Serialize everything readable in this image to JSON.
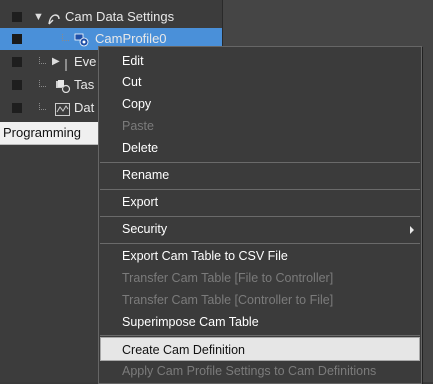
{
  "tree": {
    "items": [
      {
        "label": "Cam Data Settings",
        "expand": "▼",
        "icon": "cam-data-icon"
      },
      {
        "label": "CamProfile0",
        "icon": "cam-profile-icon"
      },
      {
        "label": "Eve",
        "expand": "▶",
        "icon": "event-icon"
      },
      {
        "label": "Tas",
        "icon": "task-icon"
      },
      {
        "label": "Dat",
        "icon": "data-trace-icon"
      }
    ],
    "programming_label": "Programming"
  },
  "context_menu": {
    "items": [
      {
        "label": "Edit",
        "enabled": true
      },
      {
        "label": "Cut",
        "enabled": true
      },
      {
        "label": "Copy",
        "enabled": true
      },
      {
        "label": "Paste",
        "enabled": false
      },
      {
        "label": "Delete",
        "enabled": true
      },
      {
        "label": "Rename",
        "enabled": true
      },
      {
        "label": "Export",
        "enabled": true
      },
      {
        "label": "Security",
        "enabled": true,
        "submenu": true
      },
      {
        "label": "Export Cam Table to CSV File",
        "enabled": true
      },
      {
        "label": "Transfer Cam Table [File to Controller]",
        "enabled": false
      },
      {
        "label": "Transfer Cam Table [Controller to File]",
        "enabled": false
      },
      {
        "label": "Superimpose Cam Table",
        "enabled": true
      },
      {
        "label": "Create Cam Definition",
        "enabled": true,
        "highlighted": true
      },
      {
        "label": "Apply Cam Profile Settings to Cam Definitions",
        "enabled": false
      }
    ]
  },
  "colors": {
    "selection": "#4a90d9",
    "menu_background": "#3b3b3b",
    "highlight": "#e6e6e6",
    "disabled_text": "#7b7b7b"
  }
}
